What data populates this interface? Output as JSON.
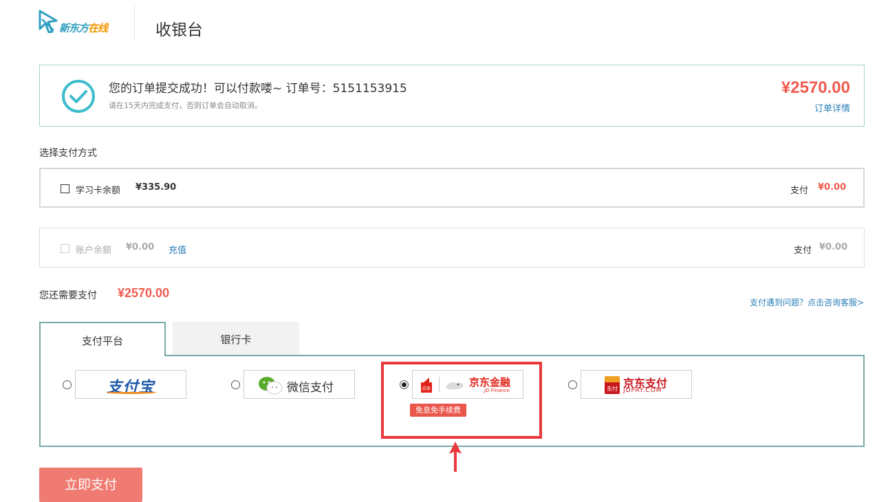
{
  "header": {
    "logo_text_main": "新东方",
    "logo_text_accent": "在线",
    "page_title": "收银台"
  },
  "order": {
    "message": "您的订单提交成功！可以付款喽~ 订单号：",
    "order_number": "5151153915",
    "subtext": "请在15天内完成支付，否则订单会自动取消。",
    "amount": "¥2570.00",
    "detail_link": "订单详情"
  },
  "payment_methods": {
    "section_label": "选择支付方式",
    "study_card": {
      "label": "学习卡余额",
      "balance": "¥335.90",
      "pay_label": "支付",
      "pay_amount": "¥0.00"
    },
    "account": {
      "label": "账户余额",
      "balance": "¥0.00",
      "recharge": "充值",
      "pay_label": "支付",
      "pay_amount": "¥0.00"
    }
  },
  "remaining": {
    "label": "您还需要支付",
    "amount": "¥2570.00",
    "help_link": "支付遇到问题？点击咨询客服>"
  },
  "tabs": [
    {
      "label": "支付平台",
      "active": true
    },
    {
      "label": "银行卡",
      "active": false
    }
  ],
  "platforms": {
    "alipay": {
      "text": "支付宝"
    },
    "wechat": {
      "text": "微信支付"
    },
    "jd_finance": {
      "text": "京东金融",
      "sub": "JD Finance",
      "icon_text": "白条",
      "badge": "免息免手续费",
      "selected": true
    },
    "jdpay": {
      "text": "京东支付",
      "sub": "JDPAY.COM",
      "icon_text": "东付"
    }
  },
  "pay_button": {
    "label": "立即支付"
  },
  "colors": {
    "accent_red": "#f05b4e",
    "link_blue": "#2a7fb8",
    "panel_border": "#7aa7a7",
    "highlight": "#e8383d"
  }
}
